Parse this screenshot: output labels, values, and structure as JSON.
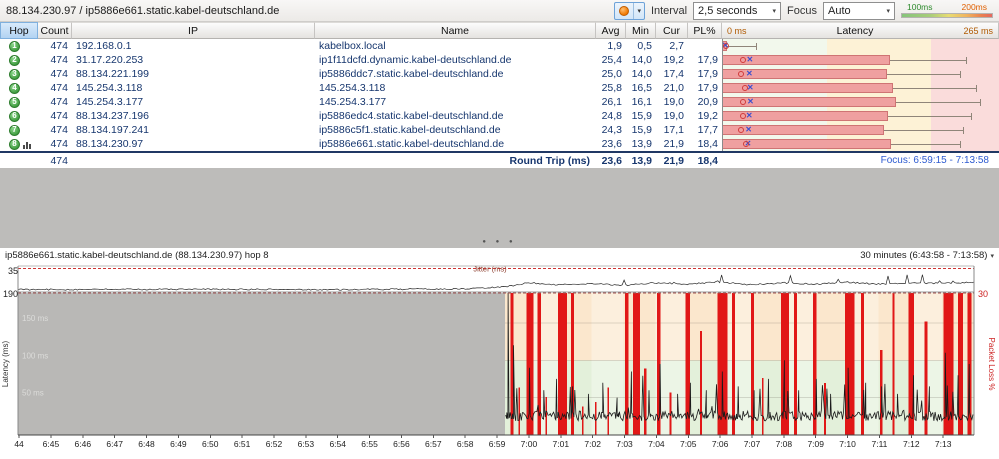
{
  "toolbar": {
    "title": "88.134.230.97 / ip5886e661.static.kabel-deutschland.de",
    "interval_label": "Interval",
    "interval_value": "2,5 seconds",
    "focus_label": "Focus",
    "focus_value": "Auto",
    "legend": {
      "low_label": "100ms",
      "high_label": "200ms"
    }
  },
  "colors": {
    "hop_badge": "#3f9c3f",
    "latency_bar": "#efa0a0",
    "packet_loss_bar": "#e11717",
    "focus_text": "#2d5bd0",
    "legend_low": "#2e8b2e",
    "legend_high": "#e06000"
  },
  "table": {
    "columns": [
      "Hop",
      "Count",
      "IP",
      "Name",
      "Avg",
      "Min",
      "Cur",
      "PL%"
    ],
    "latency_header": {
      "left": "0 ms",
      "center": "Latency",
      "right": "265 ms"
    },
    "rows": [
      {
        "hop": 1,
        "count": "474",
        "ip": "192.168.0.1",
        "name": "kabelbox.local",
        "avg": "1,9",
        "min": "0,5",
        "cur": "2,7",
        "pl": "",
        "avg_ms": 1.9,
        "cur_ms": 2.7,
        "bar_ms": 4,
        "whisker_ms": 32,
        "selected": false
      },
      {
        "hop": 2,
        "count": "474",
        "ip": "31.17.220.253",
        "name": "ip1f11dcfd.dynamic.kabel-deutschland.de",
        "avg": "25,4",
        "min": "14,0",
        "cur": "19,2",
        "pl": "17,9",
        "avg_ms": 25.4,
        "cur_ms": 19.2,
        "bar_ms": 160,
        "whisker_ms": 233,
        "selected": false
      },
      {
        "hop": 3,
        "count": "474",
        "ip": "88.134.221.199",
        "name": "ip5886ddc7.static.kabel-deutschland.de",
        "avg": "25,0",
        "min": "14,0",
        "cur": "17,4",
        "pl": "17,9",
        "avg_ms": 25.0,
        "cur_ms": 17.4,
        "bar_ms": 157,
        "whisker_ms": 228,
        "selected": false
      },
      {
        "hop": 4,
        "count": "474",
        "ip": "145.254.3.118",
        "name": "145.254.3.118",
        "avg": "25,8",
        "min": "16,5",
        "cur": "21,0",
        "pl": "17,9",
        "avg_ms": 25.8,
        "cur_ms": 21.0,
        "bar_ms": 163,
        "whisker_ms": 243,
        "selected": false
      },
      {
        "hop": 5,
        "count": "474",
        "ip": "145.254.3.177",
        "name": "145.254.3.177",
        "avg": "26,1",
        "min": "16,1",
        "cur": "19,0",
        "pl": "20,9",
        "avg_ms": 26.1,
        "cur_ms": 19.0,
        "bar_ms": 166,
        "whisker_ms": 247,
        "selected": false
      },
      {
        "hop": 6,
        "count": "474",
        "ip": "88.134.237.196",
        "name": "ip5886edc4.static.kabel-deutschland.de",
        "avg": "24,8",
        "min": "15,9",
        "cur": "19,0",
        "pl": "19,2",
        "avg_ms": 24.8,
        "cur_ms": 19.0,
        "bar_ms": 158,
        "whisker_ms": 238,
        "selected": false
      },
      {
        "hop": 7,
        "count": "474",
        "ip": "88.134.197.241",
        "name": "ip5886c5f1.static.kabel-deutschland.de",
        "avg": "24,3",
        "min": "15,9",
        "cur": "17,1",
        "pl": "17,7",
        "avg_ms": 24.3,
        "cur_ms": 17.1,
        "bar_ms": 155,
        "whisker_ms": 230,
        "selected": false
      },
      {
        "hop": 8,
        "count": "474",
        "ip": "88.134.230.97",
        "name": "ip5886e661.static.kabel-deutschland.de",
        "avg": "23,6",
        "min": "13,9",
        "cur": "21,9",
        "pl": "18,4",
        "avg_ms": 23.6,
        "cur_ms": 21.9,
        "bar_ms": 161,
        "whisker_ms": 228,
        "selected": true
      }
    ],
    "summary": {
      "count": "474",
      "label": "Round Trip (ms)",
      "avg": "23,6",
      "min": "13,9",
      "cur": "21,9",
      "pl": "18,4",
      "focus_text": "Focus: 6:59:15 - 7:13:58"
    }
  },
  "splitter": {
    "dots": "● ● ●"
  },
  "chart": {
    "title": "ip5886e661.static.kabel-deutschland.de (88.134.230.97) hop 8",
    "range_label": "30 minutes (6:43:58 - 7:13:58)",
    "jitter_label": "Jitter (ms)",
    "y_left_label": "Latency (ms)",
    "y_right_label": "Packet Loss %",
    "jitter_max": 35,
    "latency_max": 190,
    "loss_max": 30,
    "gridlines_ms": [
      150,
      100,
      50
    ],
    "gridline_labels": [
      "150 ms",
      "100 ms",
      "50 ms"
    ],
    "x_labels": [
      "44",
      "6:45",
      "6:46",
      "6:47",
      "6:48",
      "6:49",
      "6:50",
      "6:51",
      "6:52",
      "6:53",
      "6:54",
      "6:55",
      "6:56",
      "6:57",
      "6:58",
      "6:59",
      "7:00",
      "7:01",
      "7:02",
      "7:03",
      "7:04",
      "7:05",
      "7:06",
      "7:07",
      "7:08",
      "7:09",
      "7:10",
      "7:11",
      "7:12",
      "7:13"
    ],
    "total_minutes": 30,
    "focus_start_min": 15.283,
    "green_zone_max_ms": 100,
    "latency_baseline_ms": 25,
    "latency_spikes": [
      [
        15.38,
        190
      ],
      [
        15.55,
        120
      ],
      [
        16.05,
        90
      ],
      [
        16.5,
        60
      ],
      [
        16.9,
        75
      ],
      [
        17.4,
        65
      ],
      [
        17.9,
        55
      ],
      [
        18.35,
        70
      ],
      [
        18.8,
        50
      ],
      [
        19.25,
        85
      ],
      [
        19.8,
        60
      ],
      [
        20.15,
        95
      ],
      [
        20.7,
        55
      ],
      [
        21.1,
        70
      ],
      [
        21.6,
        60
      ],
      [
        22.1,
        85
      ],
      [
        22.6,
        65
      ],
      [
        23.1,
        60
      ],
      [
        23.55,
        75
      ],
      [
        24.05,
        100
      ],
      [
        24.5,
        60
      ],
      [
        25.05,
        75
      ],
      [
        25.5,
        55
      ],
      [
        26.05,
        90
      ],
      [
        26.6,
        70
      ],
      [
        27.1,
        65
      ],
      [
        27.6,
        55
      ],
      [
        28.1,
        80
      ],
      [
        28.6,
        65
      ],
      [
        29.1,
        110
      ],
      [
        29.5,
        80
      ],
      [
        29.85,
        95
      ]
    ],
    "jitter_points": [
      [
        0,
        2
      ],
      [
        5,
        2.5
      ],
      [
        10,
        2
      ],
      [
        14,
        3
      ],
      [
        15.3,
        6
      ],
      [
        16,
        12
      ],
      [
        17,
        9
      ],
      [
        18,
        11
      ],
      [
        19,
        8
      ],
      [
        20,
        12
      ],
      [
        21,
        10
      ],
      [
        22,
        13
      ],
      [
        23,
        9
      ],
      [
        24,
        12
      ],
      [
        25,
        10
      ],
      [
        26,
        13
      ],
      [
        27,
        10
      ],
      [
        28,
        12
      ],
      [
        29,
        11
      ],
      [
        30,
        13
      ]
    ],
    "packet_loss_bars": [
      [
        15.45,
        0.1,
        30
      ],
      [
        15.7,
        0.05,
        10
      ],
      [
        15.95,
        0.22,
        30
      ],
      [
        16.3,
        0.12,
        30
      ],
      [
        16.55,
        0.05,
        8
      ],
      [
        16.95,
        0.28,
        30
      ],
      [
        17.35,
        0.1,
        30
      ],
      [
        17.7,
        0.04,
        6
      ],
      [
        18.1,
        0.05,
        7
      ],
      [
        18.5,
        0.04,
        10
      ],
      [
        19.05,
        0.1,
        30
      ],
      [
        19.3,
        0.22,
        30
      ],
      [
        19.65,
        0.07,
        14
      ],
      [
        20.05,
        0.12,
        30
      ],
      [
        20.45,
        0.05,
        9
      ],
      [
        20.95,
        0.14,
        30
      ],
      [
        21.4,
        0.06,
        22
      ],
      [
        21.95,
        0.32,
        30
      ],
      [
        22.4,
        0.1,
        30
      ],
      [
        23.0,
        0.09,
        30
      ],
      [
        23.35,
        0.05,
        12
      ],
      [
        23.95,
        0.24,
        30
      ],
      [
        24.35,
        0.09,
        30
      ],
      [
        24.95,
        0.11,
        30
      ],
      [
        25.3,
        0.05,
        11
      ],
      [
        25.95,
        0.3,
        30
      ],
      [
        26.45,
        0.1,
        30
      ],
      [
        27.05,
        0.08,
        18
      ],
      [
        27.45,
        0.06,
        30
      ],
      [
        27.95,
        0.16,
        30
      ],
      [
        28.45,
        0.09,
        24
      ],
      [
        29.05,
        0.3,
        30
      ],
      [
        29.5,
        0.16,
        30
      ],
      [
        29.8,
        0.12,
        30
      ]
    ]
  }
}
